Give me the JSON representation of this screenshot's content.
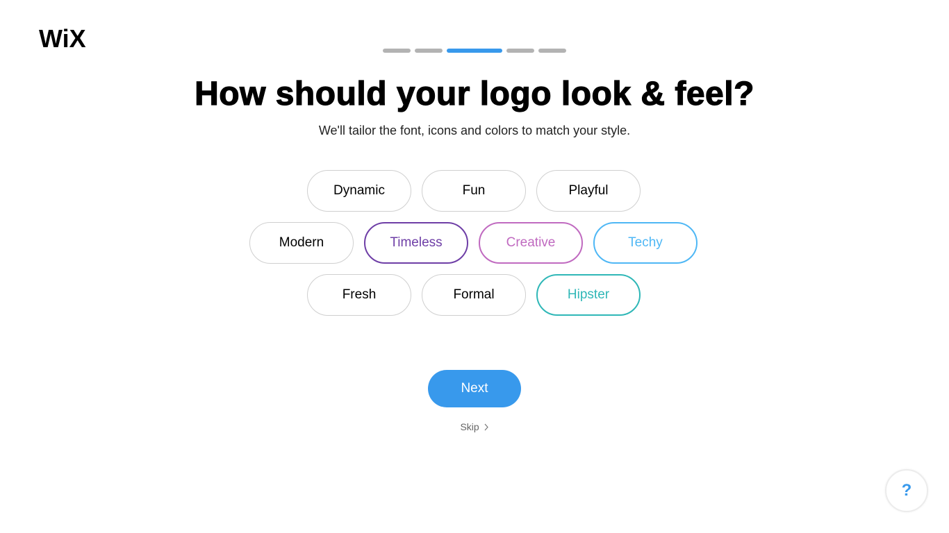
{
  "brand": {
    "logo_text": "WiX"
  },
  "progress": {
    "total_steps": 5,
    "current_step": 3
  },
  "header": {
    "title": "How should your logo look & feel?",
    "subtitle": "We'll tailor the font, icons and colors to match your style."
  },
  "styles": [
    {
      "label": "Dynamic",
      "selected": false,
      "color": "#000000"
    },
    {
      "label": "Fun",
      "selected": false,
      "color": "#000000"
    },
    {
      "label": "Playful",
      "selected": false,
      "color": "#000000"
    },
    {
      "label": "Modern",
      "selected": false,
      "color": "#000000"
    },
    {
      "label": "Timeless",
      "selected": true,
      "color": "#6e3ea6"
    },
    {
      "label": "Creative",
      "selected": true,
      "color": "#c06ac0"
    },
    {
      "label": "Techy",
      "selected": true,
      "color": "#4eb7f5"
    },
    {
      "label": "Fresh",
      "selected": false,
      "color": "#000000"
    },
    {
      "label": "Formal",
      "selected": false,
      "color": "#000000"
    },
    {
      "label": "Hipster",
      "selected": true,
      "color": "#2fb7b7"
    }
  ],
  "actions": {
    "next_label": "Next",
    "skip_label": "Skip",
    "skip_icon": "chevron-right-icon",
    "help_label": "?"
  },
  "colors": {
    "accent": "#3899ec",
    "progress_inactive": "#b3b3b3"
  }
}
